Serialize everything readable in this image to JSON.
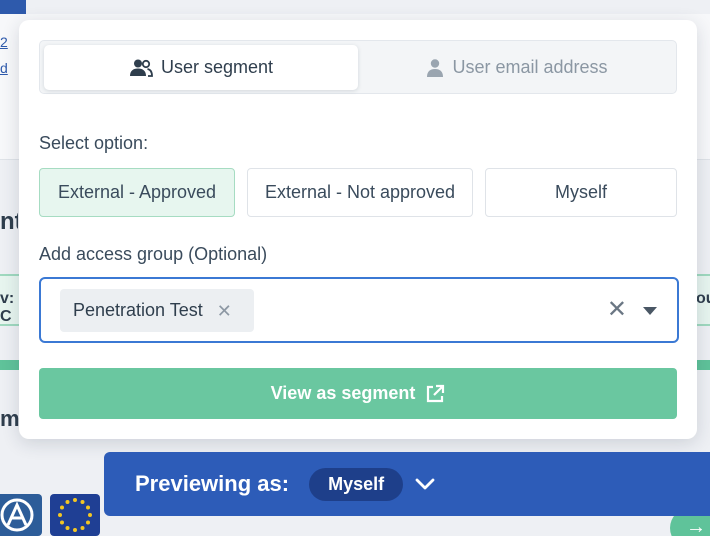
{
  "background": {
    "link_1": "2",
    "link_2": "d",
    "heading": "nt",
    "greenbar_left": "v: C",
    "greenbar_right": "ou",
    "heading_2": "me",
    "fab_icon": "arrow-right-icon"
  },
  "tabs": {
    "user_segment": {
      "label": "User segment",
      "icon": "users-icon"
    },
    "user_email": {
      "label": "User email address",
      "icon": "user-icon"
    }
  },
  "select_option": {
    "label": "Select option:",
    "options": [
      "External - Approved",
      "External - Not approved",
      "Myself"
    ],
    "selected": "External - Approved"
  },
  "access_group": {
    "label": "Add access group (Optional)",
    "chips": [
      "Penetration Test"
    ]
  },
  "view_button": {
    "label": "View as segment",
    "icon": "external-link-icon"
  },
  "preview": {
    "label": "Previewing as:",
    "value": "Myself"
  },
  "colors": {
    "accent_blue": "#2d5cb8",
    "focus_blue": "#3b79d4",
    "green": "#6ac7a0",
    "selected_bg": "#e7f6ef"
  }
}
